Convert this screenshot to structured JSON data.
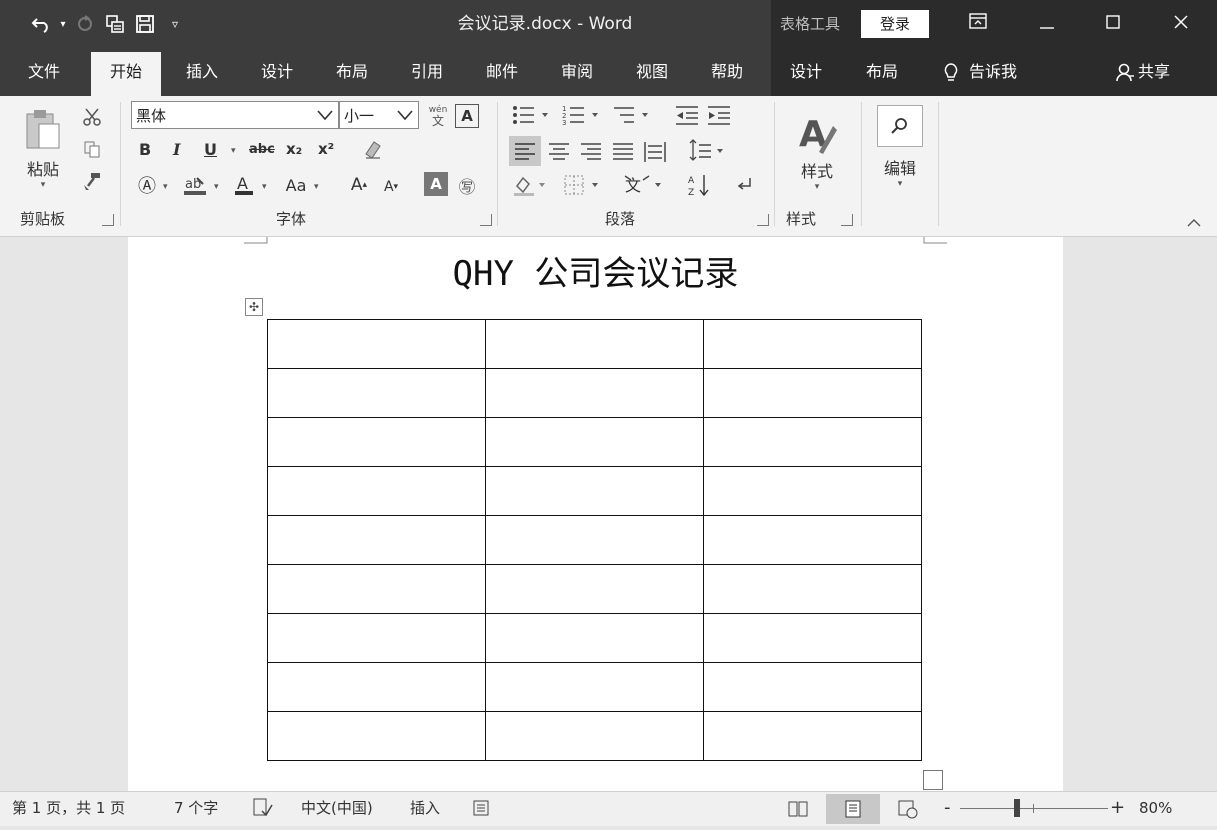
{
  "window": {
    "title": "会议记录.docx  -  Word",
    "context_label": "表格工具",
    "login_label": "登录"
  },
  "tabs": [
    {
      "label": "文件"
    },
    {
      "label": "开始"
    },
    {
      "label": "插入"
    },
    {
      "label": "设计"
    },
    {
      "label": "布局"
    },
    {
      "label": "引用"
    },
    {
      "label": "邮件"
    },
    {
      "label": "审阅"
    },
    {
      "label": "视图"
    },
    {
      "label": "帮助"
    },
    {
      "label": "设计"
    },
    {
      "label": "布局"
    }
  ],
  "tell_me": "告诉我",
  "share": "共享",
  "ribbon": {
    "clipboard": {
      "paste": "粘贴",
      "label": "剪贴板"
    },
    "font": {
      "name": "黑体",
      "size": "小一",
      "label": "字体",
      "bold": "B",
      "italic": "I",
      "underline": "U",
      "strike": "abc",
      "subscript": "x₂",
      "superscript": "x²",
      "case": "Aa",
      "grow": "A",
      "shrink": "A",
      "phonetic": "wén",
      "phonetic_sub": "文"
    },
    "paragraph": {
      "label": "段落"
    },
    "styles": {
      "button": "样式",
      "label": "样式"
    },
    "editing": {
      "button": "编辑"
    }
  },
  "document": {
    "title": "QHY 公司会议记录",
    "table": {
      "rows": 9,
      "cols": 3
    }
  },
  "status": {
    "page": "第 1 页，共 1 页",
    "words": "7 个字",
    "language": "中文(中国)",
    "mode": "插入",
    "zoom": "80%",
    "zoom_minus": "-",
    "zoom_plus": "+",
    "zoom_level": 0.8
  },
  "colors": {
    "titlebar": "#3c3c3c",
    "context": "#2b2b2b",
    "ribbon": "#f3f3f3"
  }
}
